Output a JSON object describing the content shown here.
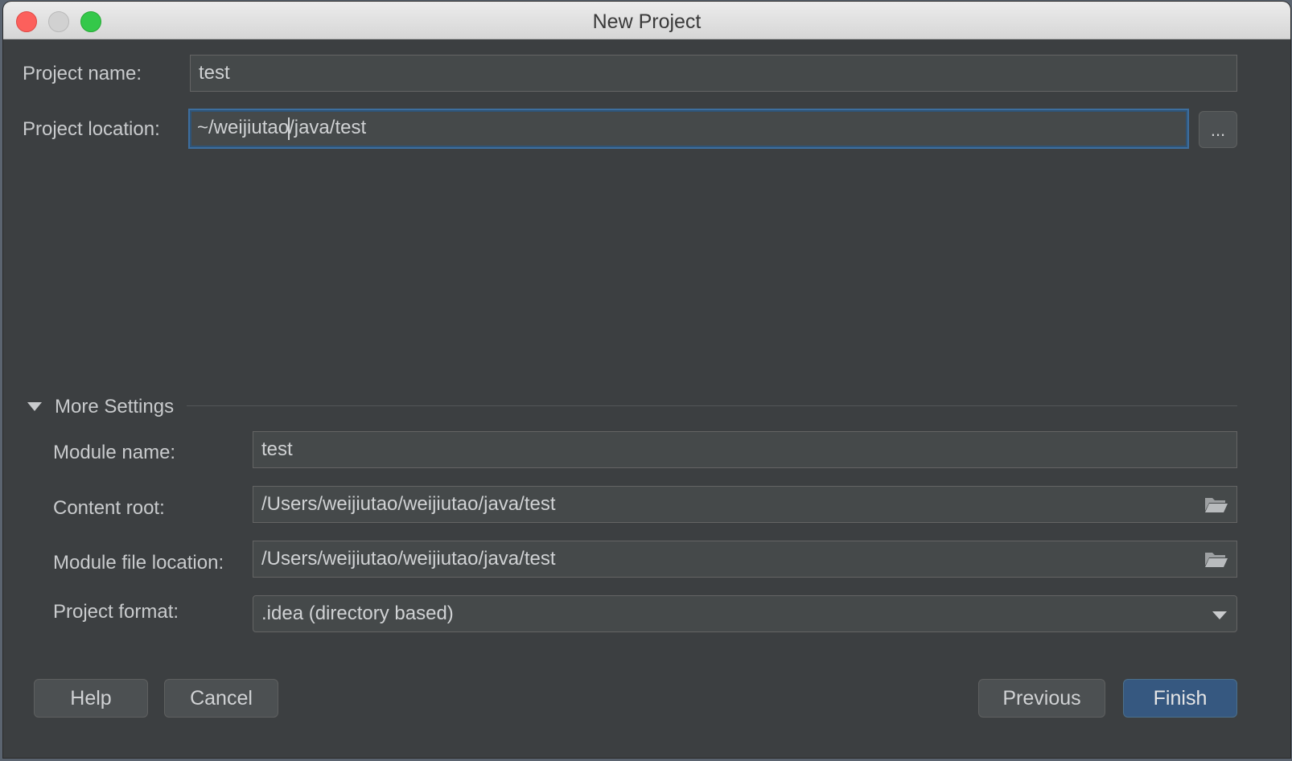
{
  "window": {
    "title": "New Project"
  },
  "project": {
    "name_label": "Project name:",
    "name_value": "test",
    "location_label": "Project location:",
    "location_before_caret": "~/weijiutao",
    "location_after_caret": "/java/test",
    "browse_label": "..."
  },
  "more_settings": {
    "header": "More Settings",
    "module_name_label": "Module name:",
    "module_name_value": "test",
    "content_root_label": "Content root:",
    "content_root_value": "/Users/weijiutao/weijiutao/java/test",
    "module_file_label": "Module file location:",
    "module_file_value": "/Users/weijiutao/weijiutao/java/test",
    "format_label": "Project format:",
    "format_value": ".idea (directory based)"
  },
  "buttons": {
    "help": "Help",
    "cancel": "Cancel",
    "previous": "Previous",
    "finish": "Finish"
  },
  "icons": {
    "folder": "folder-icon",
    "dropdown": "chevron-down-icon",
    "disclosure": "triangle-down-icon"
  },
  "colors": {
    "background": "#3c3f41",
    "field": "#45494a",
    "focus": "#3d6e9e",
    "primary_button": "#365880"
  }
}
